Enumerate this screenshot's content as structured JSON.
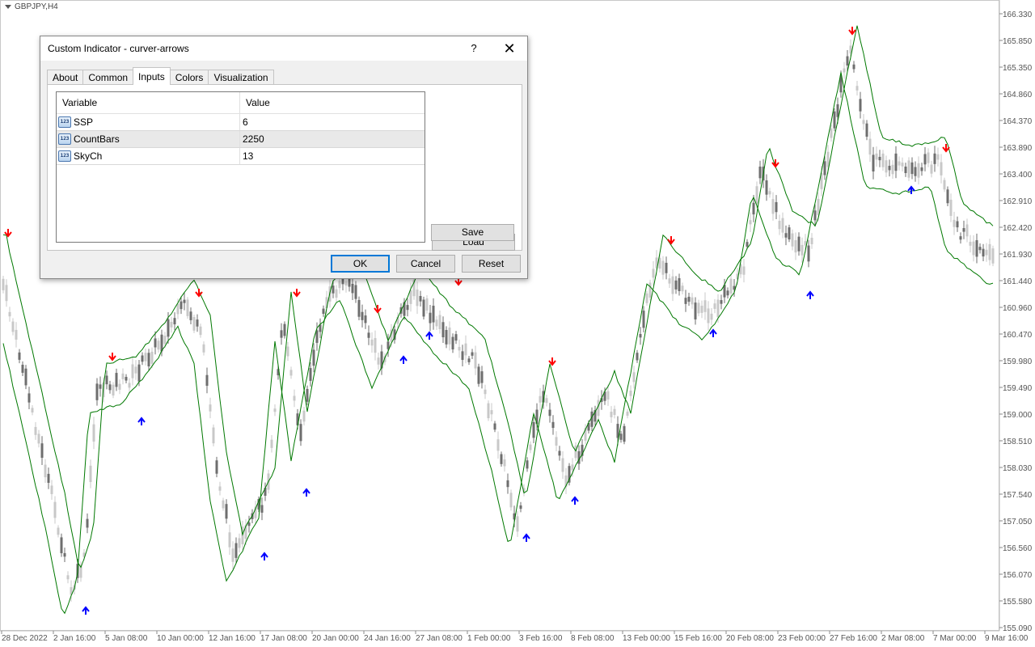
{
  "chart": {
    "symbol": "GBPJPY,H4",
    "price_axis": [
      "166.330",
      "165.850",
      "165.350",
      "164.860",
      "164.370",
      "163.890",
      "163.400",
      "162.910",
      "162.420",
      "161.930",
      "161.440",
      "160.960",
      "160.470",
      "159.980",
      "159.490",
      "159.000",
      "158.510",
      "158.030",
      "157.540",
      "157.050",
      "156.560",
      "156.070",
      "155.580",
      "155.090"
    ],
    "time_axis": [
      "28 Dec 2022",
      "2 Jan 16:00",
      "5 Jan 08:00",
      "10 Jan 00:00",
      "12 Jan 16:00",
      "17 Jan 08:00",
      "20 Jan 00:00",
      "24 Jan 16:00",
      "27 Jan 08:00",
      "1 Feb 00:00",
      "3 Feb 16:00",
      "8 Feb 08:00",
      "13 Feb 00:00",
      "15 Feb 16:00",
      "20 Feb 08:00",
      "23 Feb 00:00",
      "27 Feb 16:00",
      "2 Mar 08:00",
      "7 Mar 00:00",
      "9 Mar 16:00"
    ],
    "colors": {
      "channel": "#007800",
      "up_arrow": "#0000ff",
      "down_arrow": "#ff0000",
      "candle_dark": "#6e6e6e",
      "candle_light": "#c8c8c8"
    }
  },
  "dialog": {
    "title": "Custom Indicator - curver-arrows",
    "help": "?",
    "close": "✕",
    "tabs": [
      "About",
      "Common",
      "Inputs",
      "Colors",
      "Visualization"
    ],
    "active_tab": "Inputs",
    "columns": {
      "variable": "Variable",
      "value": "Value"
    },
    "icon_text": "123",
    "rows": [
      {
        "variable": "SSP",
        "value": "6"
      },
      {
        "variable": "CountBars",
        "value": "2250"
      },
      {
        "variable": "SkyCh",
        "value": "13"
      }
    ],
    "buttons": {
      "load": "Load",
      "save": "Save",
      "ok": "OK",
      "cancel": "Cancel",
      "reset": "Reset"
    }
  }
}
